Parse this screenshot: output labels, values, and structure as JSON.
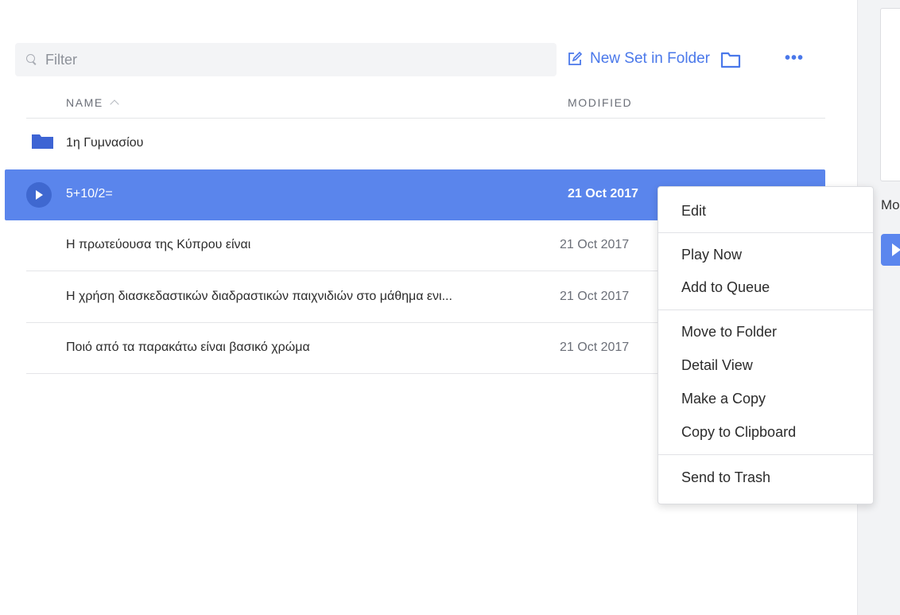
{
  "toolbar": {
    "filter_placeholder": "Filter",
    "new_set_label": "New Set in Folder",
    "more_label": "•••",
    "icons": [
      "search-icon",
      "edit-icon",
      "folder-icon",
      "more-icon"
    ],
    "accent_color": "#4a78ea"
  },
  "table": {
    "columns": {
      "name": "NAME",
      "modified": "MODIFIED"
    },
    "sort_icon": "chevron-up-icon",
    "folder_row": {
      "name": "1η Γυμνασίου",
      "icon": "folder-icon"
    },
    "rows": [
      {
        "name": "5+10/2=",
        "modified": "21 Oct 2017",
        "selected": true,
        "icon": "play-icon"
      },
      {
        "name": "Η πρωτεύουσα της Κύπρου είναι",
        "modified": "21 Oct 2017"
      },
      {
        "name": "Η χρήση διασκεδαστικών διαδραστικών παιχνιδιών στο μάθημα ενι...",
        "modified": "21 Oct 2017"
      },
      {
        "name": "Ποιό από τα παρακάτω είναι βασικό χρώμα",
        "modified": "21 Oct 2017"
      }
    ],
    "selected_color": "#5a85ec"
  },
  "context_menu": {
    "items": [
      {
        "label": "Edit"
      },
      {
        "label": "Play Now"
      },
      {
        "label": "Add to Queue"
      },
      {
        "label": "Move to Folder"
      },
      {
        "label": "Detail View"
      },
      {
        "label": "Make a Copy"
      },
      {
        "label": "Copy to Clipboard"
      },
      {
        "label": "Send to Trash"
      }
    ]
  },
  "side_panel": {
    "label_truncated": "Mo",
    "button_icon": "play-icon"
  }
}
